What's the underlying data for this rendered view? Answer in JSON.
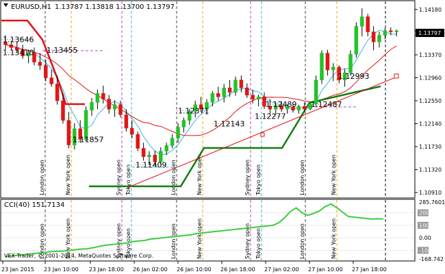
{
  "colors": {
    "bull": "#26c22b",
    "bear": "#e01616",
    "ma_red": "#e01010",
    "ma_blue": "#39b6d6",
    "trend_green": "#0f7d0f",
    "cci_green": "#3ccc3c",
    "price_box": "#000000",
    "dash_london": "#444444",
    "dash_ny": "#f0a818",
    "dash_tokyo": "#39b6d6",
    "dash_sydney": "#c040c0"
  },
  "chart_data": [
    {
      "type": "candlestick",
      "title": "EURUSD,H1",
      "ohlc_header": "1.13787 1.13818 1.13700 1.13797",
      "current_price": "1.13797",
      "ylim": [
        1.1085,
        1.143
      ],
      "y_ticks": [
        "1.14180",
        "1.13797",
        "1.13370",
        "1.12960",
        "1.12550",
        "1.12140",
        "1.11730",
        "1.11320",
        "1.10910"
      ],
      "candles": [
        {
          "o": 1.136,
          "h": 1.1372,
          "l": 1.1346,
          "c": 1.1355
        },
        {
          "o": 1.1355,
          "h": 1.1362,
          "l": 1.1345,
          "c": 1.135
        },
        {
          "o": 1.135,
          "h": 1.1361,
          "l": 1.134,
          "c": 1.1346
        },
        {
          "o": 1.1346,
          "h": 1.1355,
          "l": 1.133,
          "c": 1.1335
        },
        {
          "o": 1.1335,
          "h": 1.1346,
          "l": 1.1322,
          "c": 1.134
        },
        {
          "o": 1.134,
          "h": 1.135,
          "l": 1.1318,
          "c": 1.1324
        },
        {
          "o": 1.1324,
          "h": 1.134,
          "l": 1.131,
          "c": 1.1318
        },
        {
          "o": 1.1318,
          "h": 1.1328,
          "l": 1.129,
          "c": 1.1296
        },
        {
          "o": 1.1296,
          "h": 1.131,
          "l": 1.128,
          "c": 1.1285
        },
        {
          "o": 1.1285,
          "h": 1.13,
          "l": 1.1248,
          "c": 1.1255
        },
        {
          "o": 1.1255,
          "h": 1.1268,
          "l": 1.1214,
          "c": 1.122
        },
        {
          "o": 1.122,
          "h": 1.1235,
          "l": 1.117,
          "c": 1.1176
        },
        {
          "o": 1.1176,
          "h": 1.1215,
          "l": 1.1168,
          "c": 1.1205
        },
        {
          "o": 1.1205,
          "h": 1.122,
          "l": 1.118,
          "c": 1.1186
        },
        {
          "o": 1.1186,
          "h": 1.1245,
          "l": 1.1183,
          "c": 1.1238
        },
        {
          "o": 1.1238,
          "h": 1.126,
          "l": 1.1228,
          "c": 1.1252
        },
        {
          "o": 1.1252,
          "h": 1.1275,
          "l": 1.124,
          "c": 1.1268
        },
        {
          "o": 1.1268,
          "h": 1.1282,
          "l": 1.125,
          "c": 1.1258
        },
        {
          "o": 1.1258,
          "h": 1.1265,
          "l": 1.1232,
          "c": 1.124
        },
        {
          "o": 1.124,
          "h": 1.1256,
          "l": 1.1226,
          "c": 1.1248
        },
        {
          "o": 1.1248,
          "h": 1.1255,
          "l": 1.1225,
          "c": 1.123
        },
        {
          "o": 1.123,
          "h": 1.124,
          "l": 1.12,
          "c": 1.1206
        },
        {
          "o": 1.1206,
          "h": 1.122,
          "l": 1.1188,
          "c": 1.1195
        },
        {
          "o": 1.1195,
          "h": 1.12,
          "l": 1.1165,
          "c": 1.117
        },
        {
          "o": 1.117,
          "h": 1.118,
          "l": 1.1148,
          "c": 1.1155
        },
        {
          "o": 1.1155,
          "h": 1.1165,
          "l": 1.114,
          "c": 1.1158
        },
        {
          "o": 1.1158,
          "h": 1.1166,
          "l": 1.114,
          "c": 1.1146
        },
        {
          "o": 1.1146,
          "h": 1.1172,
          "l": 1.1141,
          "c": 1.1165
        },
        {
          "o": 1.1165,
          "h": 1.118,
          "l": 1.1158,
          "c": 1.1175
        },
        {
          "o": 1.1175,
          "h": 1.1195,
          "l": 1.117,
          "c": 1.1188
        },
        {
          "o": 1.1188,
          "h": 1.1215,
          "l": 1.118,
          "c": 1.1208
        },
        {
          "o": 1.1208,
          "h": 1.1225,
          "l": 1.1198,
          "c": 1.122
        },
        {
          "o": 1.122,
          "h": 1.124,
          "l": 1.1212,
          "c": 1.1236
        },
        {
          "o": 1.1236,
          "h": 1.1255,
          "l": 1.1225,
          "c": 1.1248
        },
        {
          "o": 1.1248,
          "h": 1.1262,
          "l": 1.1235,
          "c": 1.124
        },
        {
          "o": 1.124,
          "h": 1.1258,
          "l": 1.123,
          "c": 1.1252
        },
        {
          "o": 1.1252,
          "h": 1.1272,
          "l": 1.1245,
          "c": 1.1268
        },
        {
          "o": 1.1268,
          "h": 1.128,
          "l": 1.1255,
          "c": 1.1262
        },
        {
          "o": 1.1262,
          "h": 1.1285,
          "l": 1.1252,
          "c": 1.1278
        },
        {
          "o": 1.1278,
          "h": 1.1292,
          "l": 1.1262,
          "c": 1.127
        },
        {
          "o": 1.127,
          "h": 1.1298,
          "l": 1.1264,
          "c": 1.1292
        },
        {
          "o": 1.1292,
          "h": 1.13,
          "l": 1.127,
          "c": 1.1278
        },
        {
          "o": 1.1278,
          "h": 1.1286,
          "l": 1.126,
          "c": 1.1265
        },
        {
          "o": 1.1265,
          "h": 1.1275,
          "l": 1.125,
          "c": 1.1258
        },
        {
          "o": 1.1258,
          "h": 1.1266,
          "l": 1.1245,
          "c": 1.1262
        },
        {
          "o": 1.1262,
          "h": 1.127,
          "l": 1.124,
          "c": 1.1245
        },
        {
          "o": 1.1245,
          "h": 1.1258,
          "l": 1.1232,
          "c": 1.124
        },
        {
          "o": 1.124,
          "h": 1.125,
          "l": 1.123,
          "c": 1.1246
        },
        {
          "o": 1.1246,
          "h": 1.1254,
          "l": 1.1235,
          "c": 1.124
        },
        {
          "o": 1.124,
          "h": 1.1249,
          "l": 1.1232,
          "c": 1.1244
        },
        {
          "o": 1.1244,
          "h": 1.125,
          "l": 1.1234,
          "c": 1.1238
        },
        {
          "o": 1.1238,
          "h": 1.1248,
          "l": 1.1232,
          "c": 1.1245
        },
        {
          "o": 1.1245,
          "h": 1.1252,
          "l": 1.1236,
          "c": 1.124
        },
        {
          "o": 1.124,
          "h": 1.125,
          "l": 1.1238,
          "c": 1.1249
        },
        {
          "o": 1.1249,
          "h": 1.13,
          "l": 1.1245,
          "c": 1.1292
        },
        {
          "o": 1.1292,
          "h": 1.1345,
          "l": 1.1285,
          "c": 1.134
        },
        {
          "o": 1.134,
          "h": 1.1346,
          "l": 1.13,
          "c": 1.131
        },
        {
          "o": 1.131,
          "h": 1.1322,
          "l": 1.129,
          "c": 1.1315
        },
        {
          "o": 1.1315,
          "h": 1.1318,
          "l": 1.1286,
          "c": 1.1292
        },
        {
          "o": 1.1292,
          "h": 1.1312,
          "l": 1.128,
          "c": 1.1305
        },
        {
          "o": 1.1305,
          "h": 1.1345,
          "l": 1.13,
          "c": 1.1338
        },
        {
          "o": 1.1338,
          "h": 1.1395,
          "l": 1.1332,
          "c": 1.1388
        },
        {
          "o": 1.1388,
          "h": 1.142,
          "l": 1.137,
          "c": 1.1405
        },
        {
          "o": 1.1405,
          "h": 1.141,
          "l": 1.137,
          "c": 1.1378
        },
        {
          "o": 1.1378,
          "h": 1.1388,
          "l": 1.1345,
          "c": 1.136
        },
        {
          "o": 1.136,
          "h": 1.1378,
          "l": 1.135,
          "c": 1.1372
        },
        {
          "o": 1.1372,
          "h": 1.1385,
          "l": 1.1365,
          "c": 1.138
        },
        {
          "o": 1.138,
          "h": 1.1386,
          "l": 1.1372,
          "c": 1.1378
        },
        {
          "o": 1.1378,
          "h": 1.1382,
          "l": 1.137,
          "c": 1.138
        }
      ],
      "level_labels": [
        {
          "text": "1.13646",
          "value": 1.13646
        },
        {
          "text": "1.13410",
          "value": 1.1341
        },
        {
          "text": "1.13455",
          "value": 1.13455
        },
        {
          "text": "1.11857",
          "value": 1.11857
        },
        {
          "text": "1.11409",
          "value": 1.11409
        },
        {
          "text": "1.12371",
          "value": 1.12371
        },
        {
          "text": "1.12143",
          "value": 1.12143
        },
        {
          "text": "1.12277",
          "value": 1.12277
        },
        {
          "text": "1.12489",
          "value": 1.12489
        },
        {
          "text": "1.12487",
          "value": 1.12487
        },
        {
          "text": "1.12993",
          "value": 1.12993
        }
      ],
      "sessions": [
        {
          "name": "London open",
          "kind": "london"
        },
        {
          "name": "New York open",
          "kind": "ny"
        },
        {
          "name": "Sydney open",
          "kind": "sydney"
        },
        {
          "name": "Tokyo open",
          "kind": "tokyo"
        },
        {
          "name": "London open",
          "kind": "london"
        },
        {
          "name": "New York open",
          "kind": "ny"
        },
        {
          "name": "Sydney open",
          "kind": "sydney"
        },
        {
          "name": "Tokyo open",
          "kind": "tokyo"
        },
        {
          "name": "London open",
          "kind": "london"
        },
        {
          "name": "New York open",
          "kind": "ny"
        }
      ],
      "x_ticks": [
        "23 Jan 2015",
        "23 Jan 10:00",
        "23 Jan 18:00",
        "26 Jan 02:00",
        "26 Jan 10:00",
        "26 Jan 18:00",
        "27 Jan 02:00",
        "27 Jan 10:00",
        "27 Jan 18:00"
      ]
    },
    {
      "type": "line",
      "title": "CCI(40) 151.7134",
      "indicator": "CCI(40)",
      "value": "151.7134",
      "ylim": [
        -168.742,
        285.7601
      ],
      "y_ticks": [
        "285.7601",
        "200",
        "100",
        "0.00",
        "-100",
        "-168.742"
      ],
      "values": [
        -150,
        -145,
        -140,
        -135,
        -130,
        -125,
        -120,
        -115,
        -110,
        -108,
        -105,
        -100,
        -95,
        -90,
        -88,
        -80,
        -70,
        -60,
        -55,
        -50,
        -45,
        -40,
        -30,
        -25,
        -20,
        -10,
        -5,
        0,
        5,
        10,
        15,
        20,
        25,
        35,
        40,
        45,
        50,
        55,
        60,
        65,
        70,
        75,
        80,
        85,
        90,
        95,
        100,
        120,
        160,
        210,
        240,
        200,
        180,
        195,
        215,
        250,
        270,
        240,
        205,
        170,
        165,
        160,
        155,
        150,
        152,
        151
      ]
    }
  ],
  "watermark": "VEX Trader, © 2001-2014, MetaQuotes Software Corp."
}
